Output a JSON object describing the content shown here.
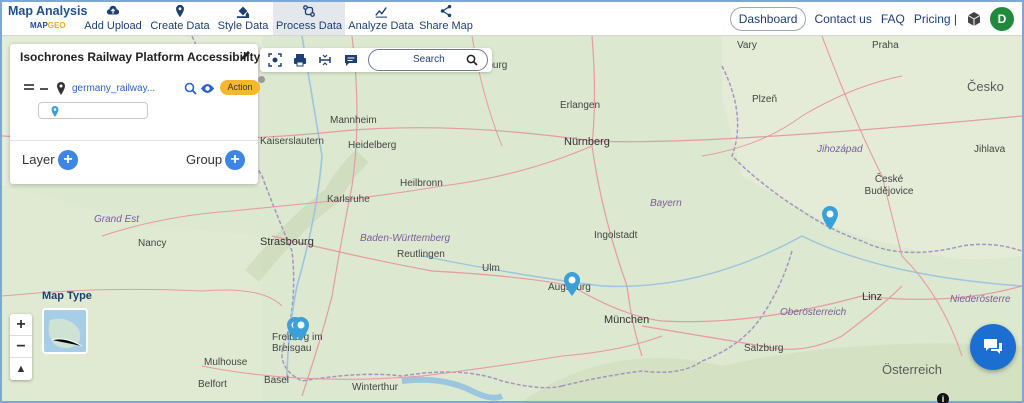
{
  "brand": {
    "title": "Map Analysis",
    "sub_prefix": "MAP",
    "sub_suffix": "GEO"
  },
  "nav": [
    {
      "label": "Add Upload",
      "icon": "cloud-upload-icon"
    },
    {
      "label": "Create Data",
      "icon": "location-pin-icon"
    },
    {
      "label": "Style Data",
      "icon": "paint-bucket-icon"
    },
    {
      "label": "Process Data",
      "icon": "process-icon",
      "active": true
    },
    {
      "label": "Analyze Data",
      "icon": "analyze-icon"
    },
    {
      "label": "Share Map",
      "icon": "share-icon"
    }
  ],
  "right_nav": {
    "dashboard": "Dashboard",
    "contact": "Contact us",
    "faq": "FAQ",
    "pricing": "Pricing |",
    "avatar_initial": "D"
  },
  "panel": {
    "title": "Isochrones Railway Platform Accessibility",
    "layer_name": "germany_railway...",
    "action_label": "Action",
    "layer_label": "Layer",
    "group_label": "Group"
  },
  "toolbar": {
    "search_placeholder": "Search"
  },
  "map_type_label": "Map Type",
  "zoom": {
    "in": "+",
    "out": "−",
    "reset": "▲"
  },
  "info": "i",
  "map_labels": {
    "cities": [
      "Würzburg",
      "Vary",
      "Praha",
      "Erlangen",
      "Mannheim",
      "Heidelberg",
      "Kaiserslautern",
      "Nürnberg",
      "Plzeň",
      "Heilbronn",
      "Karlsruhe",
      "Jihlava",
      "České Budějovice",
      "Ingolstadt",
      "Strasbourg",
      "Nancy",
      "Reutlingen",
      "Ulm",
      "Augsburg",
      "München",
      "Linz",
      "Freiburg im Breisgau",
      "Mulhouse",
      "Belfort",
      "Basel",
      "Winterthur",
      "Salzburg"
    ],
    "regions": [
      "Grand Est",
      "Baden-Württemberg",
      "Bayern",
      "Jihozápad",
      "Oberösterreich",
      "Niederösterre"
    ],
    "countries": [
      "Česko",
      "Österreich"
    ]
  },
  "colors": {
    "accent": "#3d86e6",
    "brand": "#1f4f8f",
    "action": "#f5b72b",
    "marker": "#3aa0d8",
    "avatar": "#1f8a3c"
  }
}
